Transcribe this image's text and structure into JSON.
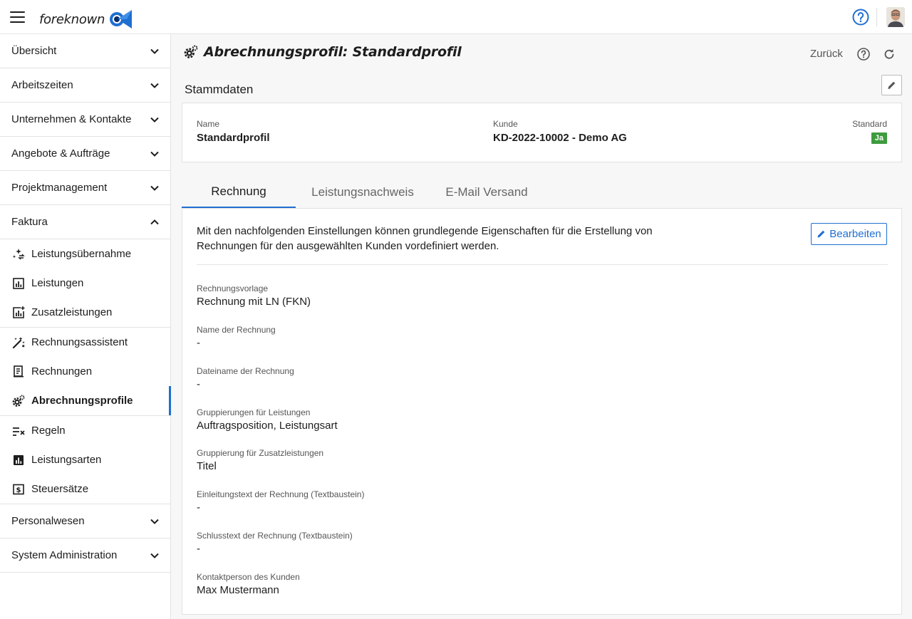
{
  "app": {
    "brand": "foreknown"
  },
  "sidebar": {
    "groups_top": [
      {
        "label": "Übersicht",
        "name": "ubersicht"
      },
      {
        "label": "Arbeitszeiten",
        "name": "arbeitszeiten"
      },
      {
        "label": "Unternehmen & Kontakte",
        "name": "unternehmen-kontakte"
      },
      {
        "label": "Angebote & Aufträge",
        "name": "angebote-auftraege"
      },
      {
        "label": "Projektmanagement",
        "name": "projektmanagement"
      },
      {
        "label": "Faktura",
        "name": "faktura",
        "expanded": true
      }
    ],
    "faktura_items": [
      {
        "label": "Leistungsübernahme",
        "icon": "sparkle-transfer-icon"
      },
      {
        "label": "Leistungen",
        "icon": "bar-chart-icon"
      },
      {
        "label": "Zusatzleistungen",
        "icon": "bar-chart-plus-icon"
      },
      {
        "label": "Rechnungsassistent",
        "icon": "magic-wand-icon"
      },
      {
        "label": "Rechnungen",
        "icon": "invoice-icon"
      },
      {
        "label": "Abrechnungsprofile",
        "icon": "gears-icon",
        "active": true
      },
      {
        "label": "Regeln",
        "icon": "rules-icon"
      },
      {
        "label": "Leistungsarten",
        "icon": "bar-chart-filled-icon"
      },
      {
        "label": "Steuersätze",
        "icon": "dollar-box-icon"
      }
    ],
    "groups_bottom": [
      {
        "label": "Personalwesen",
        "name": "personalwesen"
      },
      {
        "label": "System Administration",
        "name": "system-administration"
      }
    ]
  },
  "header": {
    "title": "Abrechnungsprofil: Standardprofil",
    "back_label": "Zurück"
  },
  "stammdaten": {
    "title": "Stammdaten",
    "name_label": "Name",
    "name_value": "Standardprofil",
    "kunde_label": "Kunde",
    "kunde_value": "KD-2022-10002 - Demo AG",
    "standard_label": "Standard",
    "standard_value": "Ja"
  },
  "tabs": [
    {
      "label": "Rechnung",
      "active": true
    },
    {
      "label": "Leistungsnachweis"
    },
    {
      "label": "E-Mail Versand"
    }
  ],
  "rechnung": {
    "description": "Mit den nachfolgenden Einstellungen können grundlegende Eigenschaften für die Erstellung von Rechnungen für den ausgewählten Kunden vordefiniert werden.",
    "edit_label": "Bearbeiten",
    "fields": [
      {
        "label": "Rechnungsvorlage",
        "value": "Rechnung mit LN (FKN)"
      },
      {
        "label": "Name der Rechnung",
        "value": "-"
      },
      {
        "label": "Dateiname der Rechnung",
        "value": "-"
      },
      {
        "label": "Gruppierungen für Leistungen",
        "value": "Auftragsposition, Leistungsart"
      },
      {
        "label": "Gruppierung für Zusatzleistungen",
        "value": "Titel"
      },
      {
        "label": "Einleitungstext der Rechnung (Textbaustein)",
        "value": "-"
      },
      {
        "label": "Schlusstext der Rechnung (Textbaustein)",
        "value": "-"
      },
      {
        "label": "Kontaktperson des Kunden",
        "value": "Max Mustermann"
      }
    ]
  },
  "colors": {
    "accent": "#1f6fd0",
    "badge": "#3e9b3e"
  }
}
